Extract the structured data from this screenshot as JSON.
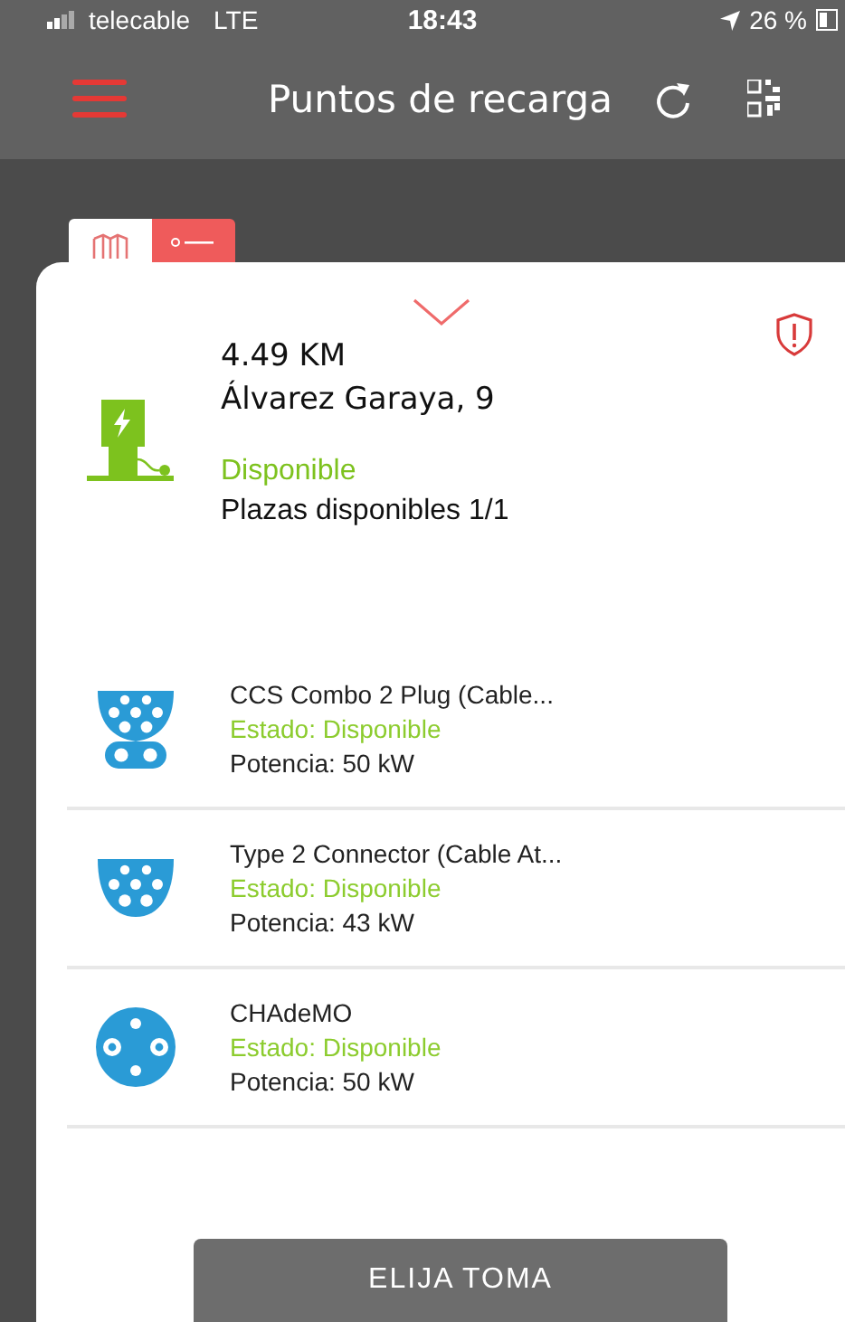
{
  "status_bar": {
    "carrier": "telecable",
    "network": "LTE",
    "time": "18:43",
    "battery": "26 %"
  },
  "nav_bar": {
    "title": "Puntos de recarga"
  },
  "view_toggle": [
    {
      "kind": "map",
      "selected": false
    },
    {
      "kind": "list",
      "selected": true
    }
  ],
  "station": {
    "distance": "4.49 KM",
    "address": "Álvarez Garaya, 9",
    "status": "Disponible",
    "spaces": "Plazas disponibles 1/1"
  },
  "connectors": [
    {
      "kind": "ccs",
      "name": "CCS Combo 2 Plug (Cable...",
      "status": "Estado: Disponible",
      "power": "Potencia: 50 kW"
    },
    {
      "kind": "type2",
      "name": "Type 2 Connector (Cable At...",
      "status": "Estado: Disponible",
      "power": "Potencia: 43 kW"
    },
    {
      "kind": "chademo",
      "name": "CHAdeMO",
      "status": "Estado: Disponible",
      "power": "Potencia: 50 kW"
    }
  ],
  "action_button": "ELIJA TOMA"
}
